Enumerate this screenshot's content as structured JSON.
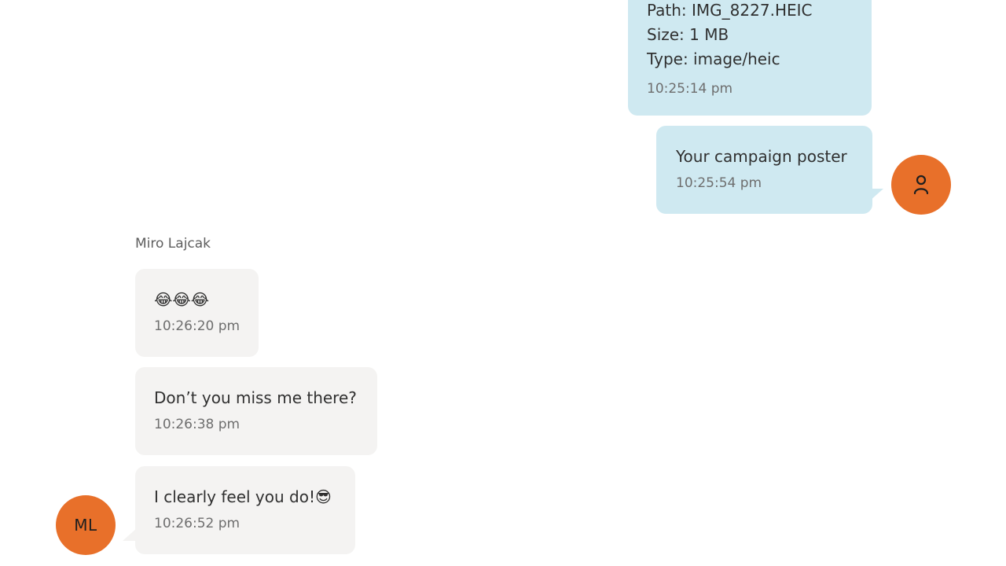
{
  "messages": {
    "file": {
      "path": "Path: IMG_8227.HEIC",
      "size": "Size: 1 MB",
      "type": "Type: image/heic",
      "time": "10:25:14 pm"
    },
    "poster": {
      "text": "Your campaign poster",
      "time": "10:25:54 pm"
    },
    "incoming_sender": "Miro Lajcak",
    "emoji": {
      "text": "😂😂😂",
      "time": "10:26:20 pm"
    },
    "miss": {
      "text": "Don’t you miss me there?",
      "time": "10:26:38 pm"
    },
    "feel": {
      "text": "I clearly feel you do!😎",
      "time": "10:26:52 pm"
    }
  },
  "avatars": {
    "self_icon": "user-icon",
    "other_initials": "ML",
    "color": "#e8702a"
  },
  "colors": {
    "outgoing_bubble": "#cfe9f1",
    "incoming_bubble": "#f4f3f2"
  }
}
